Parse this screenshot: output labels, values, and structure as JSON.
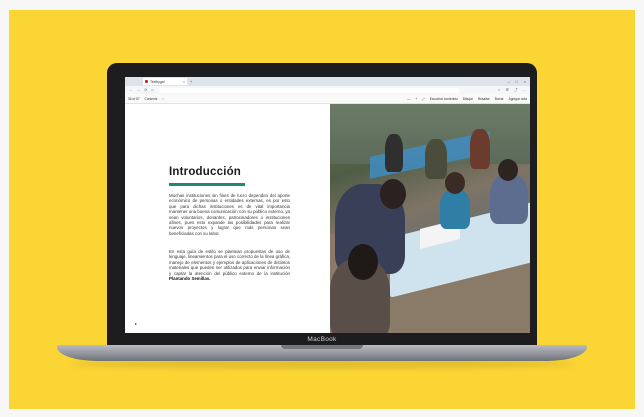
{
  "browser": {
    "tab_title": "Textbygaf",
    "new_tab": "+",
    "window_controls": [
      "–",
      "□",
      "×"
    ],
    "nav_icons": [
      "←",
      "→",
      "⟳",
      "⌂"
    ],
    "right_icons": [
      "☆",
      "☰",
      "⤴",
      "…"
    ]
  },
  "pdf_toolbar": {
    "page_indicator": "36 of 57",
    "contents_label": "Contents",
    "search_icon": "⌕",
    "zoom_minus": "—",
    "zoom_plus": "+",
    "fit_icon": "⤢",
    "read_aloud": "Escuchar contenido",
    "draw_label": "Dibujar",
    "highlight_label": "Resaltar",
    "erase_label": "Borrar",
    "add_note": "Agregar nota"
  },
  "document": {
    "heading": "Introducción",
    "paragraph_1": "Muchas instituciones sin fines de lucro dependen del aporte económico de personas o entidades externas, es por esto que para dichas instituciones es de vital importancia mantener una buena comunicación con su público externo, ya sean voluntarios, donantes, patrocinadores o instituciones afines, pues esto expande las posibilidades para realizar nuevos proyectos y lograr que más personas sean beneficiadas con su labor.",
    "paragraph_2_start": "En esta guía de estilo se plantean propuestas de uso de lenguaje, lineamientos para el uso correcto de la línea gráfica, manejo de elementos y ejemplos de aplicaciones de distintos materiales que pueden ser utilizados para enviar información y captar la atención del público externo de la institución ",
    "paragraph_2_bold": "Plantando Semillas.",
    "page_marker": "▸"
  },
  "device": {
    "brand": "MacBook"
  },
  "colors": {
    "background": "#fbd534",
    "accent_rule": "#1f8a70"
  }
}
